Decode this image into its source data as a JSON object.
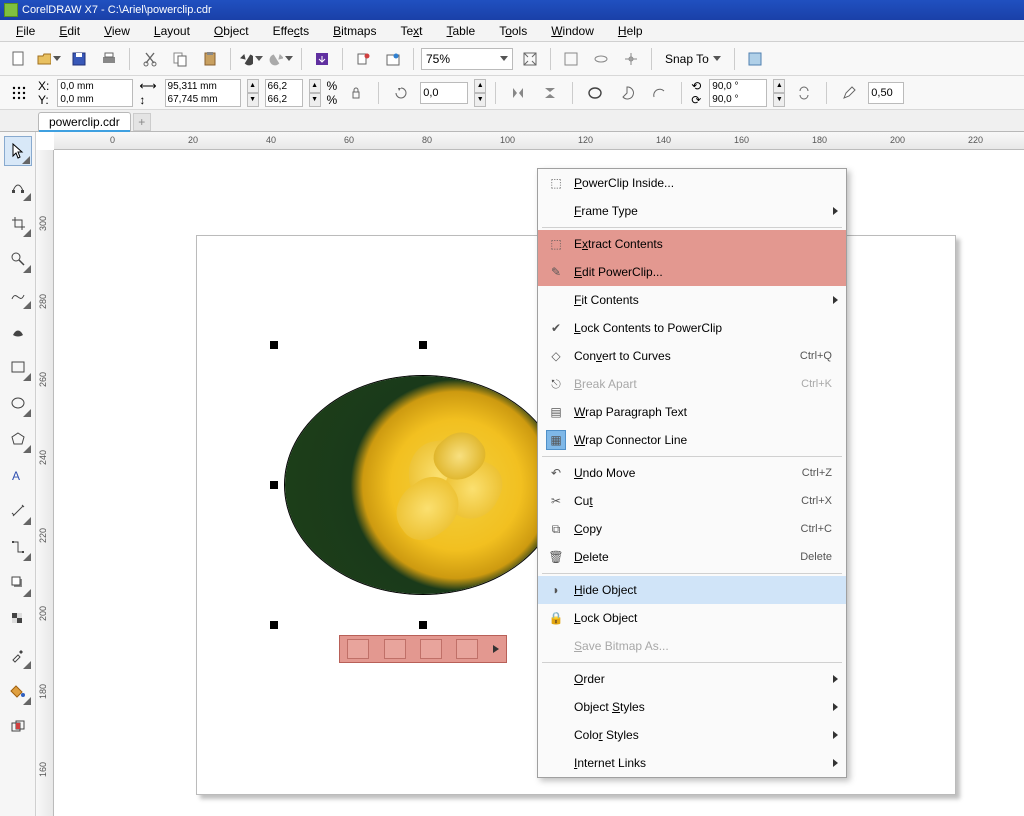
{
  "title": "CorelDRAW X7 - C:\\Ariel\\powerclip.cdr",
  "menubar": [
    "File",
    "Edit",
    "View",
    "Layout",
    "Object",
    "Effects",
    "Bitmaps",
    "Text",
    "Table",
    "Tools",
    "Window",
    "Help"
  ],
  "toolbar": {
    "zoom": "75%",
    "snap_label": "Snap To"
  },
  "propbar": {
    "x": "0,0 mm",
    "y": "0,0 mm",
    "w": "95,311 mm",
    "h": "67,745 mm",
    "sx": "66,2",
    "sy": "66,2",
    "rot": "0,0",
    "ang1": "90,0 °",
    "ang2": "90,0 °",
    "outline": "0,50"
  },
  "tab": "powerclip.cdr",
  "ruler_h": [
    "0",
    "20",
    "40",
    "60",
    "80",
    "100",
    "120",
    "140",
    "160",
    "180",
    "200",
    "220"
  ],
  "ruler_v": [
    "300",
    "280",
    "260",
    "240",
    "220",
    "200",
    "180",
    "160"
  ],
  "context_menu": [
    {
      "icon": "powerclip-inside-icon",
      "label": "PowerClip Inside...",
      "type": "item"
    },
    {
      "label": "Frame Type",
      "type": "submenu"
    },
    {
      "type": "sep"
    },
    {
      "icon": "extract-icon",
      "label": "Extract Contents",
      "type": "item",
      "hl": "red"
    },
    {
      "icon": "edit-pc-icon",
      "label": "Edit PowerClip...",
      "type": "item",
      "hl": "red"
    },
    {
      "label": "Fit Contents",
      "type": "submenu"
    },
    {
      "icon": "check-icon",
      "label": "Lock Contents to PowerClip",
      "type": "item"
    },
    {
      "icon": "convert-icon",
      "label": "Convert to Curves",
      "shortcut": "Ctrl+Q",
      "type": "item"
    },
    {
      "icon": "break-icon",
      "label": "Break Apart",
      "shortcut": "Ctrl+K",
      "type": "item",
      "disabled": true
    },
    {
      "icon": "wrap-text-icon",
      "label": "Wrap Paragraph Text",
      "type": "item"
    },
    {
      "icon": "wrap-conn-icon",
      "label": "Wrap Connector Line",
      "type": "item",
      "iconsel": true
    },
    {
      "type": "sep"
    },
    {
      "icon": "undo-icon",
      "label": "Undo Move",
      "shortcut": "Ctrl+Z",
      "type": "item"
    },
    {
      "icon": "cut-icon",
      "label": "Cut",
      "shortcut": "Ctrl+X",
      "type": "item"
    },
    {
      "icon": "copy-icon",
      "label": "Copy",
      "shortcut": "Ctrl+C",
      "type": "item"
    },
    {
      "icon": "delete-icon",
      "label": "Delete",
      "shortcut": "Delete",
      "type": "item"
    },
    {
      "type": "sep"
    },
    {
      "icon": "hide-icon",
      "label": "Hide Object",
      "type": "item",
      "hl": "blue"
    },
    {
      "icon": "lock-icon",
      "label": "Lock Object",
      "type": "item"
    },
    {
      "label": "Save Bitmap As...",
      "type": "item",
      "disabled": true
    },
    {
      "type": "sep"
    },
    {
      "label": "Order",
      "type": "submenu"
    },
    {
      "label": "Object Styles",
      "type": "submenu"
    },
    {
      "label": "Color Styles",
      "type": "submenu"
    },
    {
      "label": "Internet Links",
      "type": "submenu"
    }
  ]
}
